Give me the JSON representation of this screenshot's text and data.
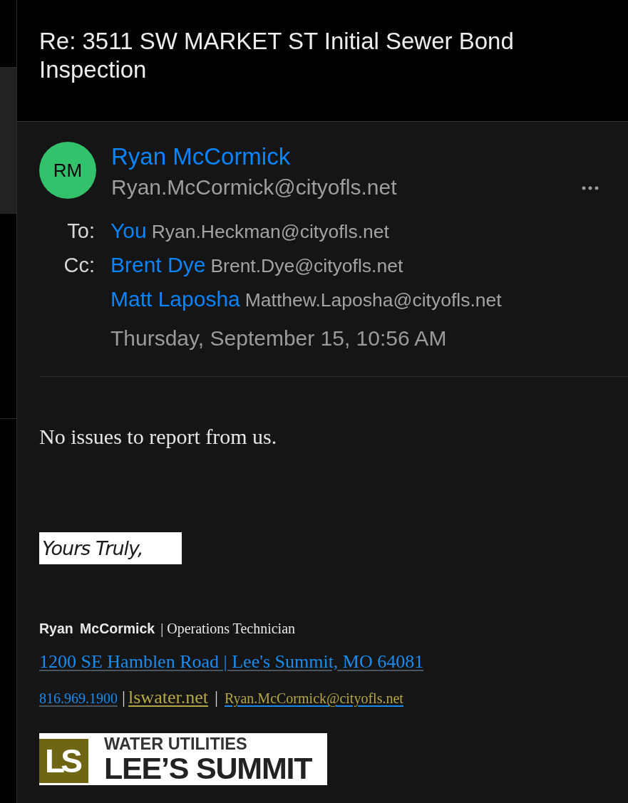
{
  "message_list": [
    {
      "selected": false
    },
    {
      "selected": true
    },
    {
      "selected": false
    }
  ],
  "subject": "Re: 3511 SW MARKET ST Initial Sewer Bond Inspection",
  "sender": {
    "initials": "RM",
    "name": "Ryan McCormick",
    "email": "Ryan.McCormick@cityofls.net"
  },
  "recipients": [
    {
      "label": "To:",
      "name": "You",
      "email": "Ryan.Heckman@cityofls.net"
    },
    {
      "label": "Cc:",
      "name": "Brent Dye",
      "email": "Brent.Dye@cityofls.net"
    },
    {
      "name": "Matt Laposha",
      "email": "Matthew.Laposha@cityofls.net"
    }
  ],
  "date": "Thursday, September 15, 10:56 AM",
  "body": {
    "text": "No issues to report from us.",
    "closing": "Yours Truly,"
  },
  "signature": {
    "name": "Ryan McCormick",
    "job_title": "| Operations Technician",
    "address": "1200 SE Hamblen Road | Lee's Summit, MO 64081",
    "phone": "816.969.1900",
    "separator_1": "|",
    "website": "lswater.net",
    "separator_2": "|",
    "email": "Ryan.McCormick@cityofls.net"
  },
  "logo": {
    "mark": "LS",
    "line_1": "WATER UTILITIES",
    "line_2": "LEE’S SUMMIT"
  }
}
